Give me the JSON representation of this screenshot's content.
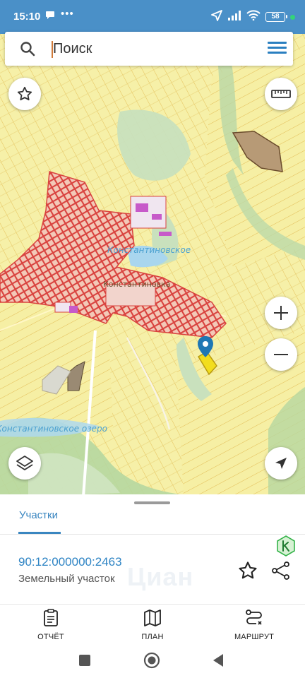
{
  "status_bar": {
    "time": "15:10",
    "battery": "58",
    "icons": [
      "chat-icon",
      "more-dots-icon",
      "location-arrow-icon",
      "signal-icon",
      "wifi-icon",
      "battery-icon"
    ]
  },
  "search": {
    "placeholder": "Поиск"
  },
  "map": {
    "labels": {
      "lake_label": "Константиновское озеро",
      "village_label": "Константиновка",
      "lake_short": "Константиновское"
    },
    "controls": [
      "favorite-icon",
      "ruler-icon",
      "zoom-in-icon",
      "zoom-out-icon",
      "layers-icon",
      "my-location-icon"
    ]
  },
  "sheet": {
    "tab_label": "Участки",
    "parcel_number": "90:12:000000:2463",
    "parcel_type": "Земельный участок",
    "watermark": "Циан"
  },
  "bottom_nav": {
    "items": [
      {
        "label": "ОТЧЁТ",
        "icon": "report-icon"
      },
      {
        "label": "ПЛАН",
        "icon": "map-plan-icon"
      },
      {
        "label": "МАРШРУТ",
        "icon": "route-icon"
      }
    ]
  },
  "colors": {
    "status_bar": "#4a90c8",
    "accent": "#2e84c4",
    "parcel_outline": "#e3b84a",
    "settlement": "#d94b4b",
    "selected_parcel": "#f2dd1e"
  }
}
